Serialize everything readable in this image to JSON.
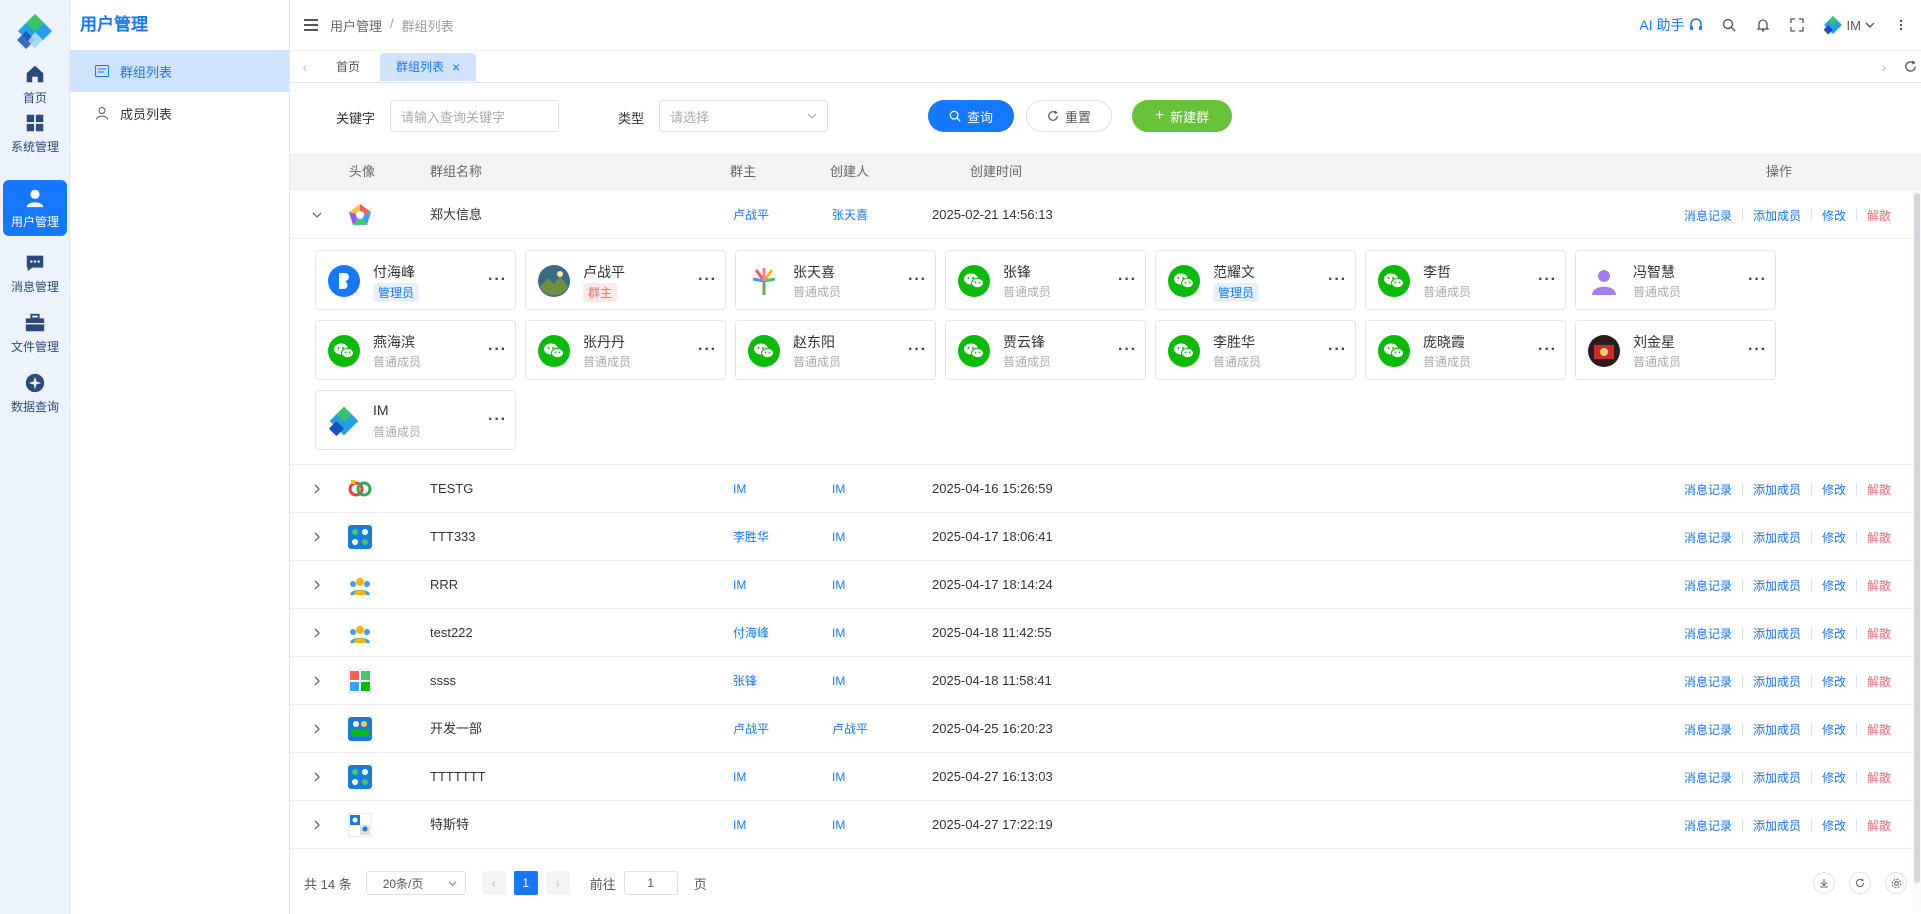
{
  "rail": {
    "items": [
      {
        "label": "首页",
        "icon": "home-icon"
      },
      {
        "label": "系统管理",
        "icon": "grid-icon"
      },
      {
        "label": "用户管理",
        "icon": "user-icon",
        "active": true
      },
      {
        "label": "消息管理",
        "icon": "chat-icon"
      },
      {
        "label": "文件管理",
        "icon": "briefcase-icon"
      },
      {
        "label": "数据查询",
        "icon": "compass-icon"
      }
    ]
  },
  "sidebar": {
    "title": "用户管理",
    "items": [
      {
        "label": "群组列表",
        "icon": "list-icon",
        "active": true
      },
      {
        "label": "成员列表",
        "icon": "person-icon"
      }
    ]
  },
  "header": {
    "breadcrumb": [
      "用户管理",
      "群组列表"
    ],
    "ai_label": "AI 助手",
    "user_name": "IM"
  },
  "tabs": [
    {
      "label": "首页"
    },
    {
      "label": "群组列表",
      "active": true
    }
  ],
  "filters": {
    "keyword_label": "关键字",
    "keyword_placeholder": "请输入查询关键字",
    "type_label": "类型",
    "type_placeholder": "请选择",
    "search_label": "查询",
    "reset_label": "重置",
    "new_label": "新建群"
  },
  "table": {
    "columns": {
      "avatar": "头像",
      "name": "群组名称",
      "owner": "群主",
      "creator": "创建人",
      "time": "创建时间",
      "ops": "操作"
    },
    "ops": {
      "history": "消息记录",
      "add": "添加成员",
      "edit": "修改",
      "dissolve": "解散"
    },
    "expanded": {
      "name": "郑大信息",
      "owner": "卢战平",
      "creator": "张天喜",
      "time": "2025-02-21 14:56:13",
      "members": [
        {
          "name": "付海峰",
          "role": "管理员",
          "role_type": "admin",
          "avatar": "blue-b"
        },
        {
          "name": "卢战平",
          "role": "群主",
          "role_type": "owner",
          "avatar": "photo"
        },
        {
          "name": "张天喜",
          "role": "普通成员",
          "role_type": "member",
          "avatar": "palm"
        },
        {
          "name": "张锋",
          "role": "普通成员",
          "role_type": "member",
          "avatar": "wechat"
        },
        {
          "name": "范耀文",
          "role": "管理员",
          "role_type": "admin",
          "avatar": "wechat"
        },
        {
          "name": "李哲",
          "role": "普通成员",
          "role_type": "member",
          "avatar": "wechat"
        },
        {
          "name": "冯智慧",
          "role": "普通成员",
          "role_type": "member",
          "avatar": "person"
        },
        {
          "name": "燕海滨",
          "role": "普通成员",
          "role_type": "member",
          "avatar": "wechat"
        },
        {
          "name": "张丹丹",
          "role": "普通成员",
          "role_type": "member",
          "avatar": "wechat"
        },
        {
          "name": "赵东阳",
          "role": "普通成员",
          "role_type": "member",
          "avatar": "wechat"
        },
        {
          "name": "贾云锋",
          "role": "普通成员",
          "role_type": "member",
          "avatar": "wechat"
        },
        {
          "name": "李胜华",
          "role": "普通成员",
          "role_type": "member",
          "avatar": "wechat"
        },
        {
          "name": "庞晓霞",
          "role": "普通成员",
          "role_type": "member",
          "avatar": "wechat"
        },
        {
          "name": "刘金星",
          "role": "普通成员",
          "role_type": "member",
          "avatar": "dark"
        },
        {
          "name": "IM",
          "role": "普通成员",
          "role_type": "member",
          "avatar": "logo"
        }
      ]
    },
    "rows": [
      {
        "name": "TESTG",
        "owner": "IM",
        "creator": "IM",
        "time": "2025-04-16 15:26:59"
      },
      {
        "name": "TTT333",
        "owner": "李胜华",
        "creator": "IM",
        "time": "2025-04-17 18:06:41"
      },
      {
        "name": "RRR",
        "owner": "IM",
        "creator": "IM",
        "time": "2025-04-17 18:14:24"
      },
      {
        "name": "test222",
        "owner": "付海峰",
        "creator": "IM",
        "time": "2025-04-18 11:42:55"
      },
      {
        "name": "ssss",
        "owner": "张锋",
        "creator": "IM",
        "time": "2025-04-18 11:58:41"
      },
      {
        "name": "开发一部",
        "owner": "卢战平",
        "creator": "卢战平",
        "time": "2025-04-25 16:20:23"
      },
      {
        "name": "TTTTTTT",
        "owner": "IM",
        "creator": "IM",
        "time": "2025-04-27 16:13:03"
      },
      {
        "name": "特斯特",
        "owner": "IM",
        "creator": "IM",
        "time": "2025-04-27 17:22:19"
      }
    ]
  },
  "pagination": {
    "total": "共 14 条",
    "page_size": "20条/页",
    "current_page": "1",
    "goto_label": "前往",
    "goto_value": "1",
    "page_suffix": "页"
  },
  "colors": {
    "primary": "#1677ff",
    "success": "#67c23a",
    "danger": "#f56c6c",
    "wechat": "#09bb07"
  }
}
